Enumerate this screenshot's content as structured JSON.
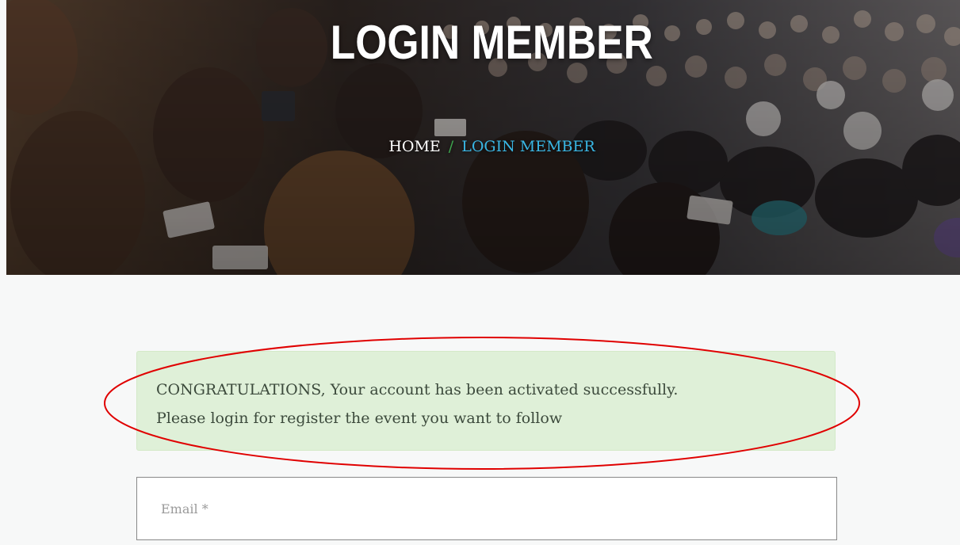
{
  "hero": {
    "title": "LOGIN MEMBER",
    "breadcrumb": {
      "home": "HOME",
      "separator": "/",
      "current": "LOGIN MEMBER"
    }
  },
  "alert": {
    "line1": "CONGRATULATIONS, Your account has been activated successfully.",
    "line2": "Please login for register the event you want to follow"
  },
  "form": {
    "email_placeholder": "Email *",
    "email_value": ""
  },
  "colors": {
    "breadcrumb_current": "#39b6e4",
    "breadcrumb_separator": "#3ea84f",
    "alert_background": "#dff0d8",
    "annotation_ellipse": "#e00000"
  }
}
